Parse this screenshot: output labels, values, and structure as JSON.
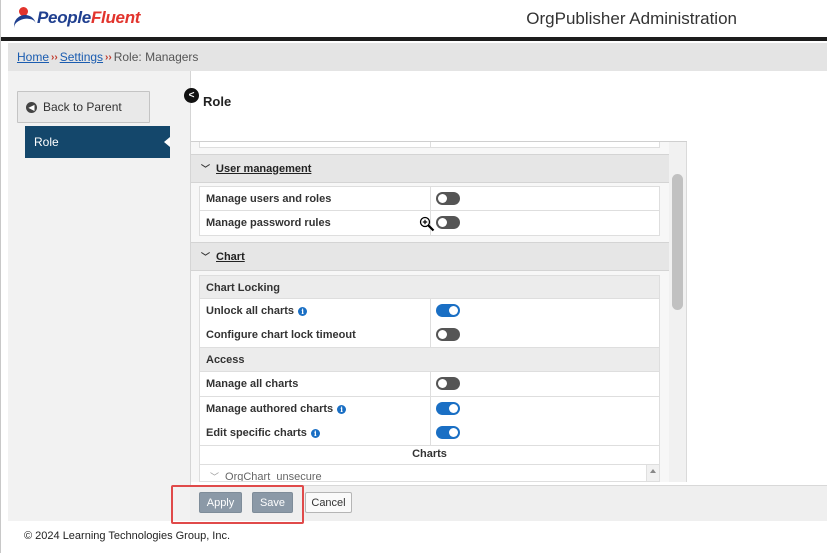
{
  "header": {
    "logo_text_people": "People",
    "logo_text_fluent": "Fluent",
    "app_title": "OrgPublisher Administration"
  },
  "breadcrumb": {
    "items": [
      {
        "label": "Home"
      },
      {
        "label": "Settings"
      },
      {
        "label": "Role: Managers"
      }
    ],
    "separator": "››"
  },
  "sidebar": {
    "back_label": "Back to Parent",
    "items": [
      {
        "label": "Role",
        "active": true
      }
    ]
  },
  "main": {
    "title": "Role",
    "sections": [
      {
        "title": "User management",
        "rows": [
          {
            "label": "Manage users and roles",
            "enabled": false,
            "info": false
          },
          {
            "label": "Manage password rules",
            "enabled": false,
            "info": false
          }
        ]
      },
      {
        "title": "Chart",
        "groups": [
          {
            "title": "Chart Locking",
            "rows": [
              {
                "label": "Unlock all charts",
                "enabled": true,
                "info": true
              },
              {
                "label": "Configure chart lock timeout",
                "enabled": false,
                "info": false
              }
            ]
          },
          {
            "title": "Access",
            "rows": [
              {
                "label": "Manage all charts",
                "enabled": false,
                "info": false
              },
              {
                "label": "Manage authored charts",
                "enabled": true,
                "info": true
              },
              {
                "label": "Edit specific charts",
                "enabled": true,
                "info": true
              }
            ]
          }
        ],
        "charts_header": "Charts",
        "chart_list": [
          "OrgChart_unsecure"
        ]
      }
    ]
  },
  "footer": {
    "apply_label": "Apply",
    "save_label": "Save",
    "cancel_label": "Cancel",
    "copyright": "© 2024 Learning Technologies Group, Inc."
  },
  "colors": {
    "brand_blue": "#1f3f8f",
    "brand_red": "#e2342d",
    "nav_active": "#14476b",
    "toggle_on": "#1a6fc4",
    "toggle_off": "#555555",
    "highlight": "#e04a4a"
  },
  "icons": {
    "back": "arrow-left-circle-icon",
    "collapse": "chevron-left-circle-icon",
    "info": "info-icon",
    "section_chevron": "chevron-down-icon",
    "cursor": "zoom-in-icon"
  }
}
